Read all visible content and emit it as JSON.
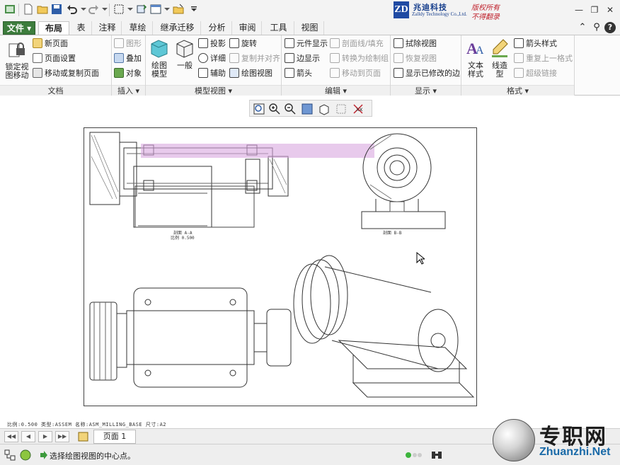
{
  "brand": {
    "logo": "ZD",
    "name_cn": "兆迪科技",
    "name_en": "Zalldy Technology Co.,Ltd.",
    "right1": "版权所有",
    "right2": "不得翻录"
  },
  "tabs": [
    "文件",
    "布局",
    "表",
    "注释",
    "草绘",
    "继承迁移",
    "分析",
    "审阅",
    "工具",
    "视图"
  ],
  "active_tab": "布局",
  "ribbon": {
    "doc": {
      "label": "文档",
      "lock": "锁定视\n图移动",
      "new_page": "新页面",
      "page_setup": "页面设置",
      "move_copy": "移动或复制页面"
    },
    "insert": {
      "label": "插入",
      "shape": "图形",
      "overlay": "叠加",
      "object": "对象"
    },
    "model_view": {
      "label": "模型视图",
      "drawing_model": "绘图\n模型",
      "general": "一般",
      "projection": "投影",
      "detail": "详细",
      "auxiliary": "辅助",
      "rotate": "旋转",
      "copy_align": "复制并对齐",
      "drawing_view": "绘图视图"
    },
    "edit": {
      "label": "编辑",
      "elem_display": "元件显示",
      "edge_display": "边显示",
      "arrow": "箭头",
      "section_fill": "剖面线/填充",
      "convert_draw": "转换为绘制组",
      "move_page": "移动到页面"
    },
    "display": {
      "label": "显示",
      "erase_view": "拭除视图",
      "restore_view": "恢复视图",
      "show_modified": "显示已修改的边"
    },
    "format": {
      "label": "格式",
      "text_style": "文本\n样式",
      "line_style": "线造\n型",
      "arrow_style": "箭头样式",
      "repeat_fmt": "重复上一格式",
      "hyperlink": "超级链接"
    }
  },
  "drawing": {
    "view_label_1": "剖面 A-A",
    "view_label_1b": "比例 0.500",
    "view_label_2": "剖面 B-B",
    "status_info": "比例:0.500   类型:ASSEM   名称:ASM_MILLING_BASE   尺寸:A2"
  },
  "page": {
    "tab": "页面 1"
  },
  "status": {
    "message": "选择绘图视图的中心点。"
  },
  "watermark": {
    "cn": "专职网",
    "url": "Zhuanzhi.Net"
  },
  "colors": {
    "file_tab": "#3d7d3d",
    "brand_blue": "#163e8c",
    "brand_red": "#c0242f",
    "watermark_blue": "#1a6aa8"
  }
}
